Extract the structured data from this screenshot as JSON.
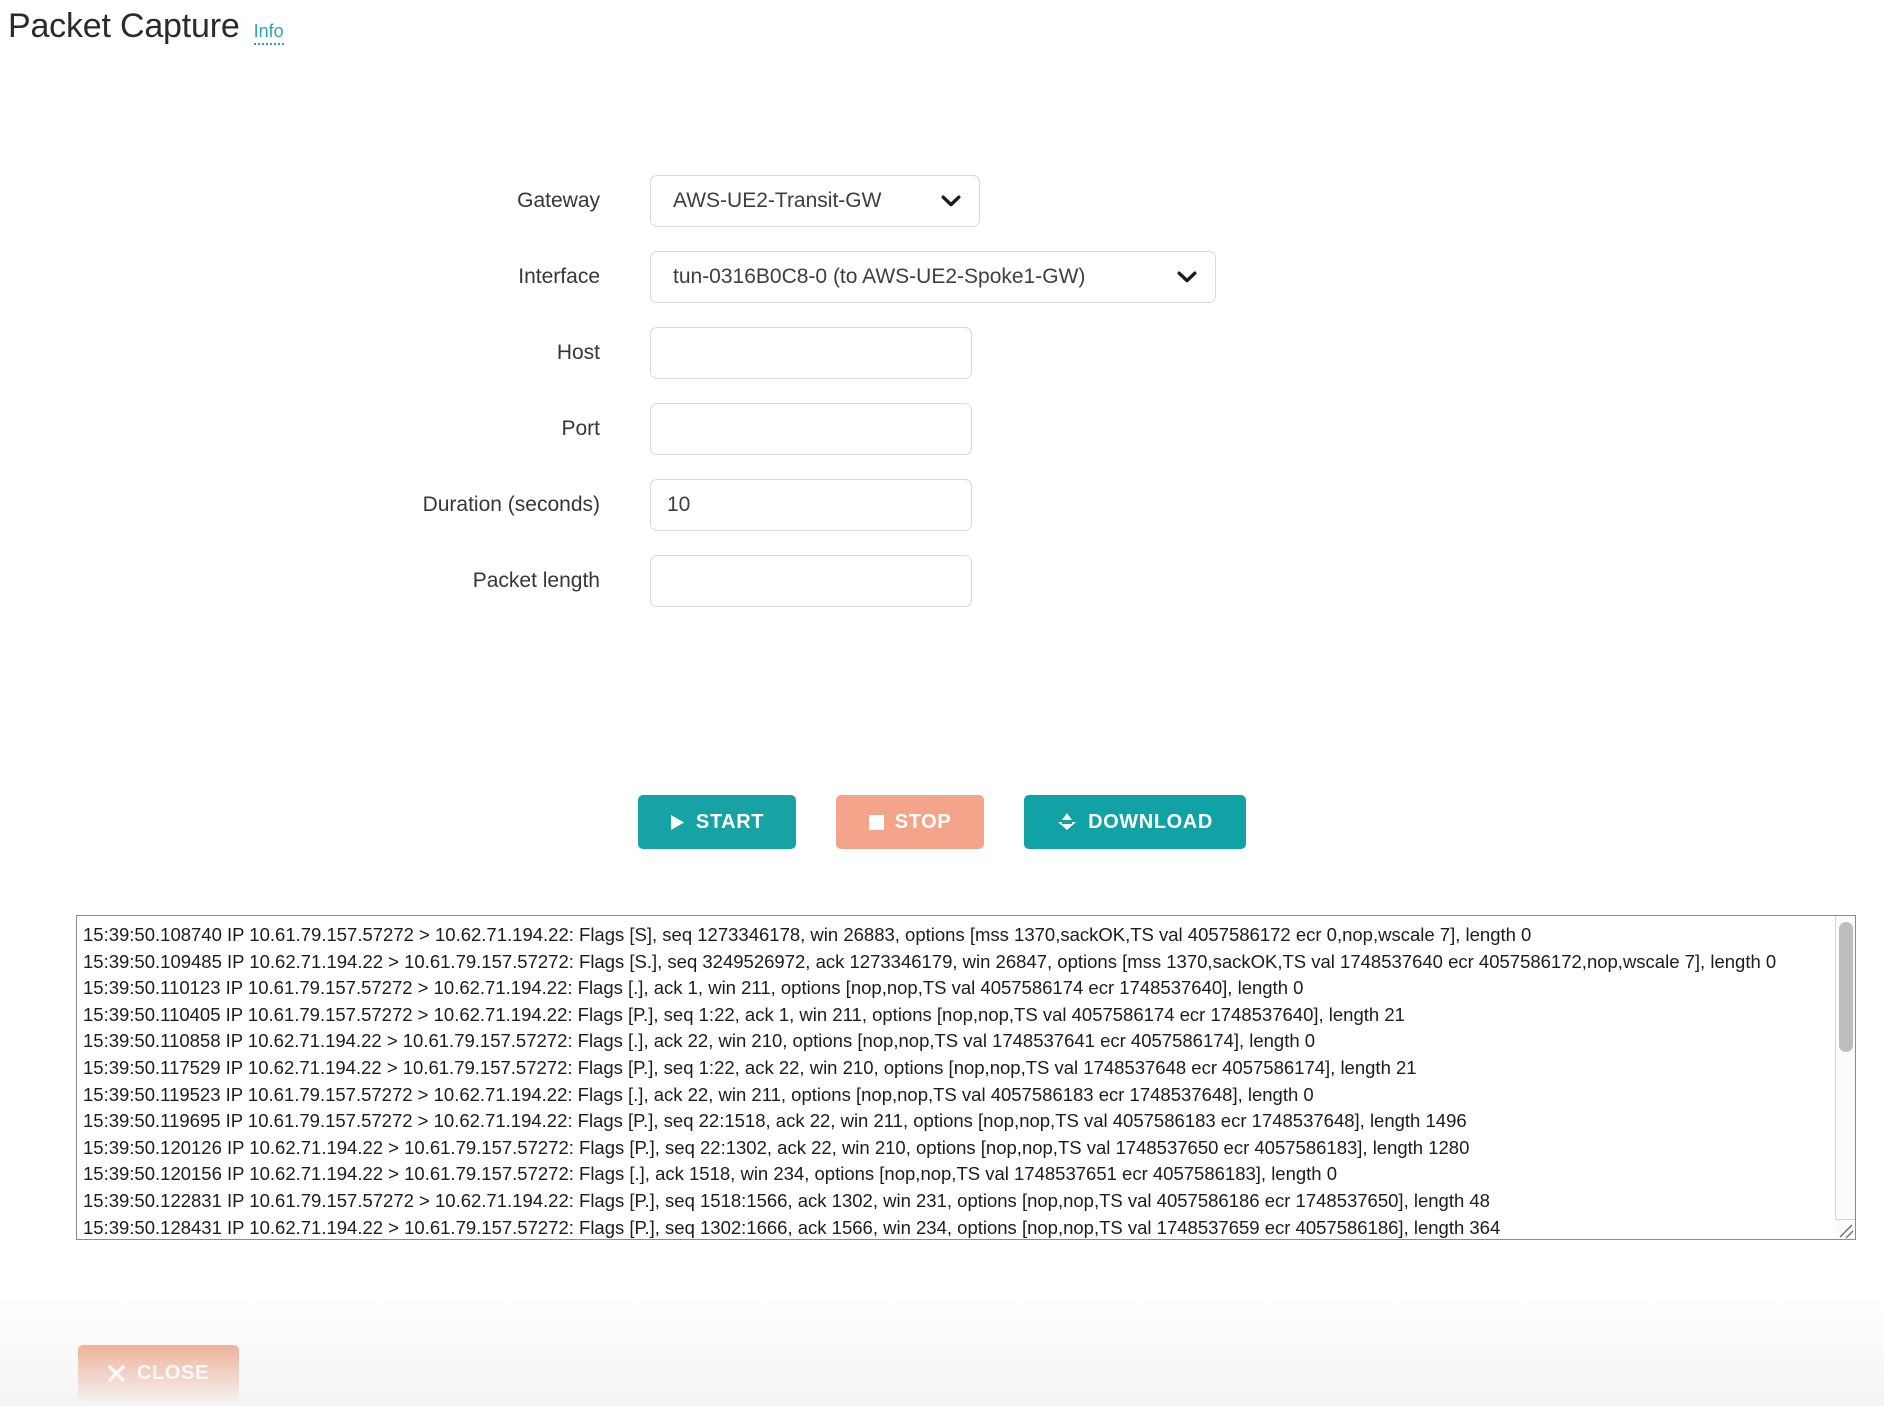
{
  "header": {
    "title": "Packet Capture",
    "info_link": "Info"
  },
  "form": {
    "gateway": {
      "label": "Gateway",
      "value": "AWS-UE2-Transit-GW"
    },
    "interface": {
      "label": "Interface",
      "value": "tun-0316B0C8-0 (to AWS-UE2-Spoke1-GW)"
    },
    "host": {
      "label": "Host",
      "value": "",
      "placeholder": ""
    },
    "port": {
      "label": "Port",
      "value": "",
      "placeholder": ""
    },
    "duration": {
      "label": "Duration (seconds)",
      "value": "10",
      "placeholder": ""
    },
    "packet_length": {
      "label": "Packet length",
      "value": "",
      "placeholder": ""
    }
  },
  "actions": {
    "start": {
      "label": "START",
      "icon": "play-icon",
      "color": "#17a3a6"
    },
    "stop": {
      "label": "STOP",
      "icon": "square-icon",
      "color": "#f4a48a"
    },
    "download": {
      "label": "DOWNLOAD",
      "icon": "download-icon",
      "color": "#11a2a5"
    },
    "close": {
      "label": "CLOSE",
      "icon": "close-x-icon",
      "color": "#e87f55"
    }
  },
  "log": {
    "lines": [
      "15:39:50.108740 IP 10.61.79.157.57272 > 10.62.71.194.22: Flags [S], seq 1273346178, win 26883, options [mss 1370,sackOK,TS val 4057586172 ecr 0,nop,wscale 7], length 0",
      "15:39:50.109485 IP 10.62.71.194.22 > 10.61.79.157.57272: Flags [S.], seq 3249526972, ack 1273346179, win 26847, options [mss 1370,sackOK,TS val 1748537640 ecr 4057586172,nop,wscale 7], length 0",
      "15:39:50.110123 IP 10.61.79.157.57272 > 10.62.71.194.22: Flags [.], ack 1, win 211, options [nop,nop,TS val 4057586174 ecr 1748537640], length 0",
      "15:39:50.110405 IP 10.61.79.157.57272 > 10.62.71.194.22: Flags [P.], seq 1:22, ack 1, win 211, options [nop,nop,TS val 4057586174 ecr 1748537640], length 21",
      "15:39:50.110858 IP 10.62.71.194.22 > 10.61.79.157.57272: Flags [.], ack 22, win 210, options [nop,nop,TS val 1748537641 ecr 4057586174], length 0",
      "15:39:50.117529 IP 10.62.71.194.22 > 10.61.79.157.57272: Flags [P.], seq 1:22, ack 22, win 210, options [nop,nop,TS val 1748537648 ecr 4057586174], length 21",
      "15:39:50.119523 IP 10.61.79.157.57272 > 10.62.71.194.22: Flags [.], ack 22, win 211, options [nop,nop,TS val 4057586183 ecr 1748537648], length 0",
      "15:39:50.119695 IP 10.61.79.157.57272 > 10.62.71.194.22: Flags [P.], seq 22:1518, ack 22, win 211, options [nop,nop,TS val 4057586183 ecr 1748537648], length 1496",
      "15:39:50.120126 IP 10.62.71.194.22 > 10.61.79.157.57272: Flags [P.], seq 22:1302, ack 22, win 210, options [nop,nop,TS val 1748537650 ecr 4057586183], length 1280",
      "15:39:50.120156 IP 10.62.71.194.22 > 10.61.79.157.57272: Flags [.], ack 1518, win 234, options [nop,nop,TS val 1748537651 ecr 4057586183], length 0",
      "15:39:50.122831 IP 10.61.79.157.57272 > 10.62.71.194.22: Flags [P.], seq 1518:1566, ack 1302, win 231, options [nop,nop,TS val 4057586186 ecr 1748537650], length 48",
      "15:39:50.128431 IP 10.62.71.194.22 > 10.61.79.157.57272: Flags [P.], seq 1302:1666, ack 1566, win 234, options [nop,nop,TS val 1748537659 ecr 4057586186], length 364"
    ]
  }
}
